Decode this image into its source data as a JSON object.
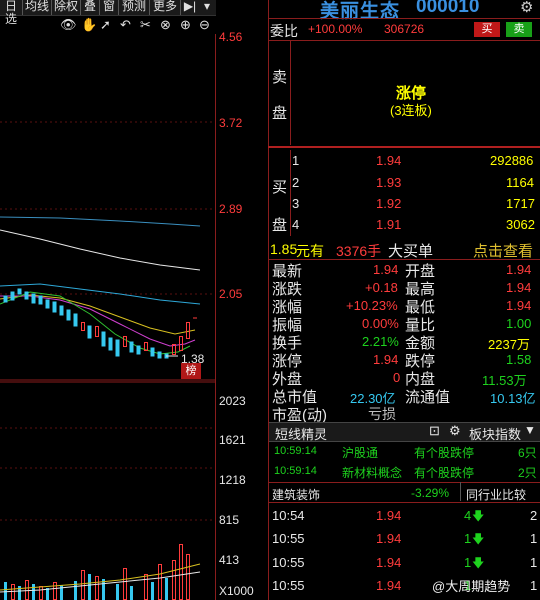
{
  "toolbar": {
    "items": [
      "日选",
      "均线",
      "除权",
      "叠",
      "窗",
      "预测",
      "更多"
    ]
  },
  "price_axis": {
    "labels": [
      "4.56",
      "3.72",
      "2.89",
      "2.05"
    ],
    "low_label": "1.38",
    "rank_badge": "榜"
  },
  "volume_axis": {
    "labels": [
      "2023",
      "1621",
      "1218",
      "815",
      "413",
      "X1000"
    ]
  },
  "stock": {
    "name": "美丽生态",
    "code": "000010"
  },
  "weibi": {
    "label": "委比",
    "pct": "+100.00%",
    "diff": "306726",
    "buy_btn": "买",
    "sell_btn": "卖"
  },
  "sell_side": {
    "label_1": "卖",
    "label_2": "盘",
    "status": "涨停",
    "sub": "(3连板)"
  },
  "buy_side": {
    "label_1": "买",
    "label_2": "盘",
    "rows": [
      {
        "level": "1",
        "price": "1.94",
        "vol": "292886"
      },
      {
        "level": "2",
        "price": "1.93",
        "vol": "1164"
      },
      {
        "level": "3",
        "price": "1.92",
        "vol": "1717"
      },
      {
        "level": "4",
        "price": "1.91",
        "vol": "3062"
      }
    ]
  },
  "big_order": {
    "price": "1.85",
    "unit": "元有",
    "vol": "3376手",
    "label": "大买单",
    "link": "点击查看"
  },
  "quote": [
    {
      "k1": "最新",
      "v1": "1.94",
      "k2": "开盘",
      "v2": "1.94"
    },
    {
      "k1": "涨跌",
      "v1": "+0.18",
      "k2": "最高",
      "v2": "1.94"
    },
    {
      "k1": "涨幅",
      "v1": "+10.23%",
      "k2": "最低",
      "v2": "1.94"
    },
    {
      "k1": "振幅",
      "v1": "0.00%",
      "k2": "量比",
      "v2": "1.00"
    },
    {
      "k1": "换手",
      "v1": "2.21%",
      "k2": "金额",
      "v2": "2237万"
    },
    {
      "k1": "涨停",
      "v1": "1.94",
      "k2": "跌停",
      "v2": "1.58"
    },
    {
      "k1": "外盘",
      "v1": "0",
      "k2": "内盘",
      "v2": "11.53万"
    },
    {
      "k1": "总市值",
      "v1": "22.30亿",
      "k2": "流通值",
      "v2": "10.13亿"
    },
    {
      "k1": "市盈(动)",
      "v1": "亏损",
      "k2": "",
      "v2": ""
    }
  ],
  "short_line": {
    "title": "短线精灵",
    "index_label": "板块指数",
    "events": [
      {
        "time": "10:59:14",
        "sector": "沪股通",
        "event": "有个股跌停",
        "count": "6只"
      },
      {
        "time": "10:59:14",
        "sector": "新材料概念",
        "event": "有个股跌停",
        "count": "2只"
      }
    ]
  },
  "sector": {
    "name": "建筑装饰",
    "change": "-3.29%",
    "compare": "同行业比较"
  },
  "ticks": [
    {
      "time": "10:54",
      "price": "1.94",
      "vol": "4",
      "n": "2"
    },
    {
      "time": "10:55",
      "price": "1.94",
      "vol": "1",
      "n": "1"
    },
    {
      "time": "10:55",
      "price": "1.94",
      "vol": "1",
      "n": "1"
    },
    {
      "time": "10:55",
      "price": "1.94",
      "vol": "1",
      "n": "1"
    }
  ],
  "watermark": "@大周期趋势",
  "colors": {
    "up": "#ff3c3c",
    "down": "#1ed21e",
    "accent": "#ffff00"
  }
}
